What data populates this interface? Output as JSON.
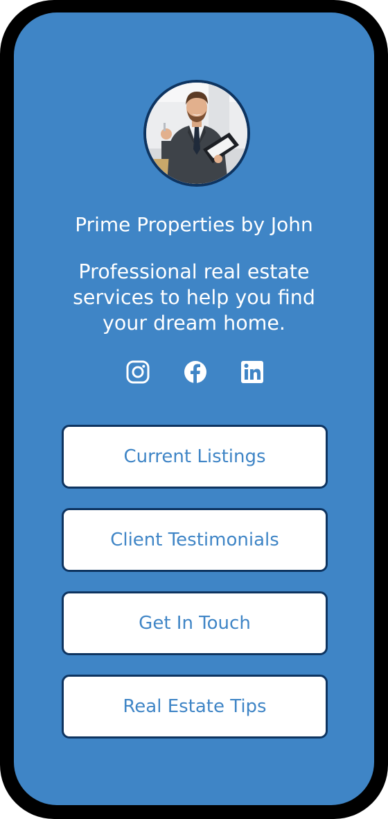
{
  "profile": {
    "name": "Prime Properties by John",
    "description": "Professional real estate services to help you find your dream home."
  },
  "socials": [
    {
      "icon": "instagram-icon"
    },
    {
      "icon": "facebook-icon"
    },
    {
      "icon": "linkedin-icon"
    }
  ],
  "links": [
    {
      "label": "Current Listings"
    },
    {
      "label": "Client Testimonials"
    },
    {
      "label": "Get In Touch"
    },
    {
      "label": "Real Estate Tips"
    }
  ],
  "colors": {
    "background": "#3f85c6",
    "frame": "#000000",
    "button_border": "#0e3460",
    "button_text": "#3f85c6",
    "text": "#ffffff"
  }
}
